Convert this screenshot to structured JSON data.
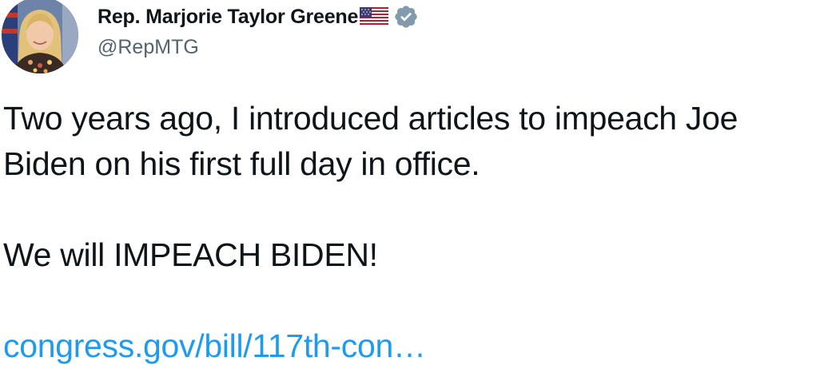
{
  "author": {
    "display_name": "Rep. Marjorie Taylor Greene",
    "handle": "@RepMTG",
    "flag_icon": "us-flag-icon",
    "verified_icon": "verified-badge-icon",
    "verified_color": "#829aab"
  },
  "tweet": {
    "line1": "Two years ago, I introduced articles to impeach Joe",
    "line2": "Biden on his first full day in office.",
    "line3": "We will IMPEACH BIDEN!",
    "link_text": "congress.gov/bill/117th-con…",
    "link_color": "#1d9bf0"
  }
}
